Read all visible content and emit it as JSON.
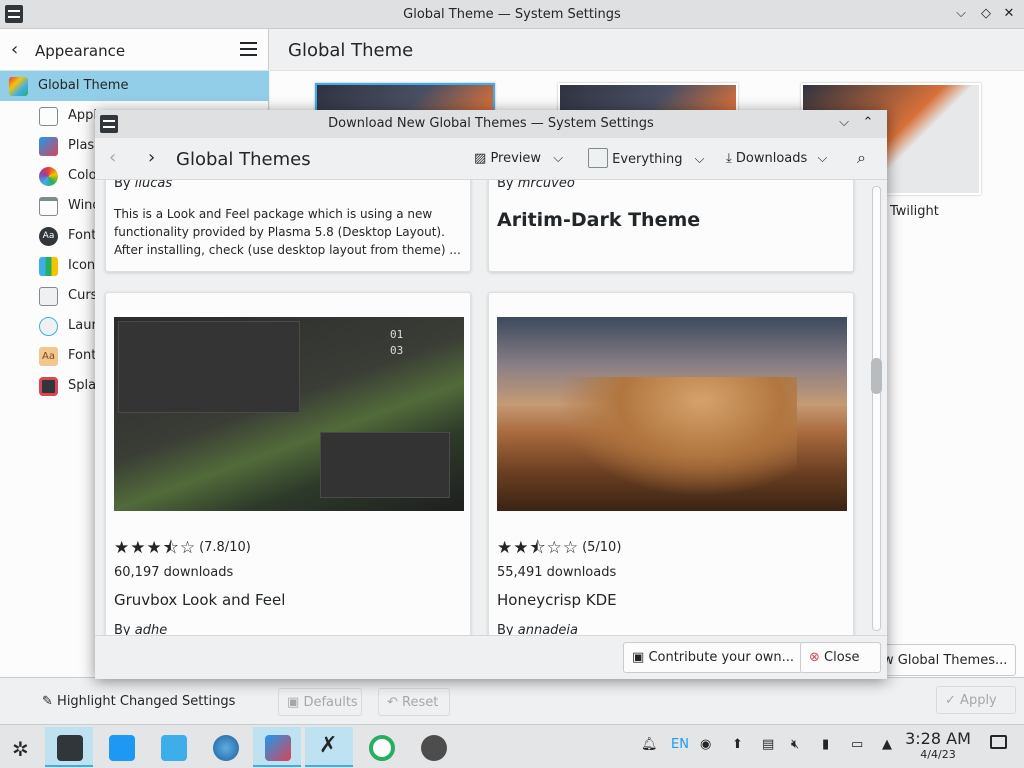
{
  "window": {
    "title": "Global Theme — System Settings"
  },
  "sidebar": {
    "back_label": "Appearance",
    "items": [
      {
        "label": "Global Theme",
        "icon": "global-theme-icon"
      },
      {
        "label": "Appl",
        "icon": "application-style-icon"
      },
      {
        "label": "Plasm",
        "icon": "plasma-style-icon"
      },
      {
        "label": "Colo",
        "icon": "colors-icon"
      },
      {
        "label": "Wind",
        "icon": "window-decorations-icon"
      },
      {
        "label": "Font",
        "icon": "fonts-icon"
      },
      {
        "label": "Icon",
        "icon": "icons-icon"
      },
      {
        "label": "Curs",
        "icon": "cursors-icon"
      },
      {
        "label": "Laun",
        "icon": "launch-feedback-icon"
      },
      {
        "label": "Font",
        "icon": "font-management-icon"
      },
      {
        "label": "Splas",
        "icon": "splash-screen-icon"
      }
    ]
  },
  "main": {
    "title": "Global Theme",
    "thumb_label_twilight": "Twilight",
    "get_new_label": "ew Global Themes..."
  },
  "bottombar": {
    "highlight_label": "Highlight Changed Settings",
    "defaults_label": "Defaults",
    "reset_label": "Reset",
    "apply_label": "Apply"
  },
  "dialog": {
    "title": "Download New Global Themes — System Settings",
    "heading": "Global Themes",
    "preview_label": "Preview",
    "filter_label": "Everything",
    "sort_label": "Downloads",
    "cards": [
      {
        "by_prefix": "By ",
        "author": "llucas",
        "description": "This is a Look and Feel package which is using a new functionality provided by Plasma 5.8 (Desktop Layout). After installing, check (use desktop layout from theme) ..."
      },
      {
        "by_prefix": "By ",
        "author": "mrcuveo",
        "big_title": "Aritim-Dark Theme"
      },
      {
        "rating_text": "(7.8/10)",
        "rating": 7.8,
        "downloads": "60,197 downloads",
        "name": "Gruvbox Look and Feel",
        "by_prefix": "By ",
        "author": "adhe"
      },
      {
        "rating_text": "(5/10)",
        "rating": 5,
        "downloads": "55,491 downloads",
        "name": "Honeycrisp KDE",
        "by_prefix": "By ",
        "author": "annadeia"
      }
    ],
    "contribute_label": "Contribute your own...",
    "close_label": "Close"
  },
  "taskbar": {
    "tray_lang": "EN",
    "time": "3:28 AM",
    "date": "4/4/23"
  },
  "colors": {
    "accent": "#3daee9",
    "selection": "#93cee9"
  }
}
